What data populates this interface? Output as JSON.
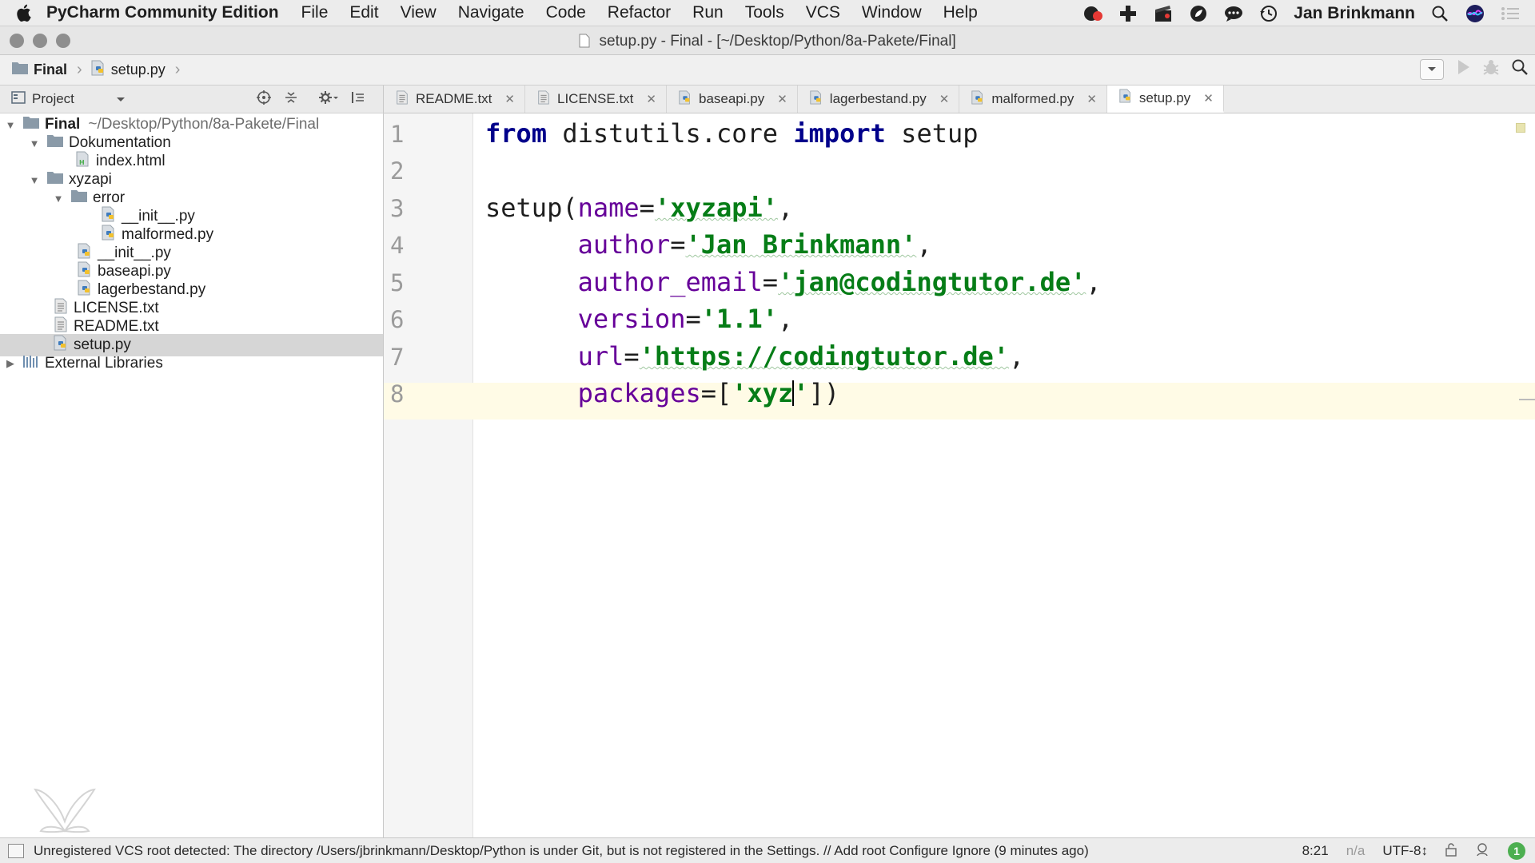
{
  "menubar": {
    "app_name": "PyCharm Community Edition",
    "items": [
      "File",
      "Edit",
      "View",
      "Navigate",
      "Code",
      "Refactor",
      "Run",
      "Tools",
      "VCS",
      "Window",
      "Help"
    ],
    "user": "Jan Brinkmann"
  },
  "window": {
    "title": "setup.py - Final - [~/Desktop/Python/8a-Pakete/Final]"
  },
  "breadcrumbs": [
    "Final",
    "setup.py"
  ],
  "project_panel": {
    "label": "Project"
  },
  "tree": [
    {
      "label": "Final",
      "path": "~/Desktop/Python/8a-Pakete/Final"
    },
    {
      "label": "Dokumentation"
    },
    {
      "label": "index.html"
    },
    {
      "label": "xyzapi"
    },
    {
      "label": "error"
    },
    {
      "label": "__init__.py"
    },
    {
      "label": "malformed.py"
    },
    {
      "label": "__init__.py"
    },
    {
      "label": "baseapi.py"
    },
    {
      "label": "lagerbestand.py"
    },
    {
      "label": "LICENSE.txt"
    },
    {
      "label": "README.txt"
    },
    {
      "label": "setup.py"
    },
    {
      "label": "External Libraries"
    }
  ],
  "tabs": [
    "README.txt",
    "LICENSE.txt",
    "baseapi.py",
    "lagerbestand.py",
    "malformed.py",
    "setup.py"
  ],
  "editor": {
    "line_numbers": [
      "1",
      "2",
      "3",
      "4",
      "5",
      "6",
      "7",
      "8"
    ],
    "l1": {
      "kw1": "from",
      "mod": " distutils.core ",
      "kw2": "import",
      "name": " setup"
    },
    "l3": {
      "pre": "setup(",
      "param": "name",
      "eq": "=",
      "str": "'xyzapi'",
      "post": ","
    },
    "l4": {
      "pre": "      ",
      "param": "author",
      "eq": "=",
      "str": "'Jan Brinkmann'",
      "post": ","
    },
    "l5": {
      "pre": "      ",
      "param": "author_email",
      "eq": "=",
      "str": "'jan@codingtutor.de'",
      "post": ","
    },
    "l6": {
      "pre": "      ",
      "param": "version",
      "eq": "=",
      "str": "'1.1'",
      "post": ","
    },
    "l7": {
      "pre": "      ",
      "param": "url",
      "eq": "=",
      "str": "'https://codingtutor.de'",
      "post": ","
    },
    "l8": {
      "pre": "      ",
      "param": "packages",
      "eq": "=[",
      "str": "'xyz",
      "str_end": "'",
      "post": "])"
    }
  },
  "status": {
    "message": "Unregistered VCS root detected: The directory /Users/jbrinkmann/Desktop/Python is under Git, but is not registered in the Settings. // Add root  Configure  Ignore (9 minutes ago)",
    "position": "8:21",
    "na": "n/a",
    "encoding": "UTF-8↕",
    "event_count": "1"
  }
}
